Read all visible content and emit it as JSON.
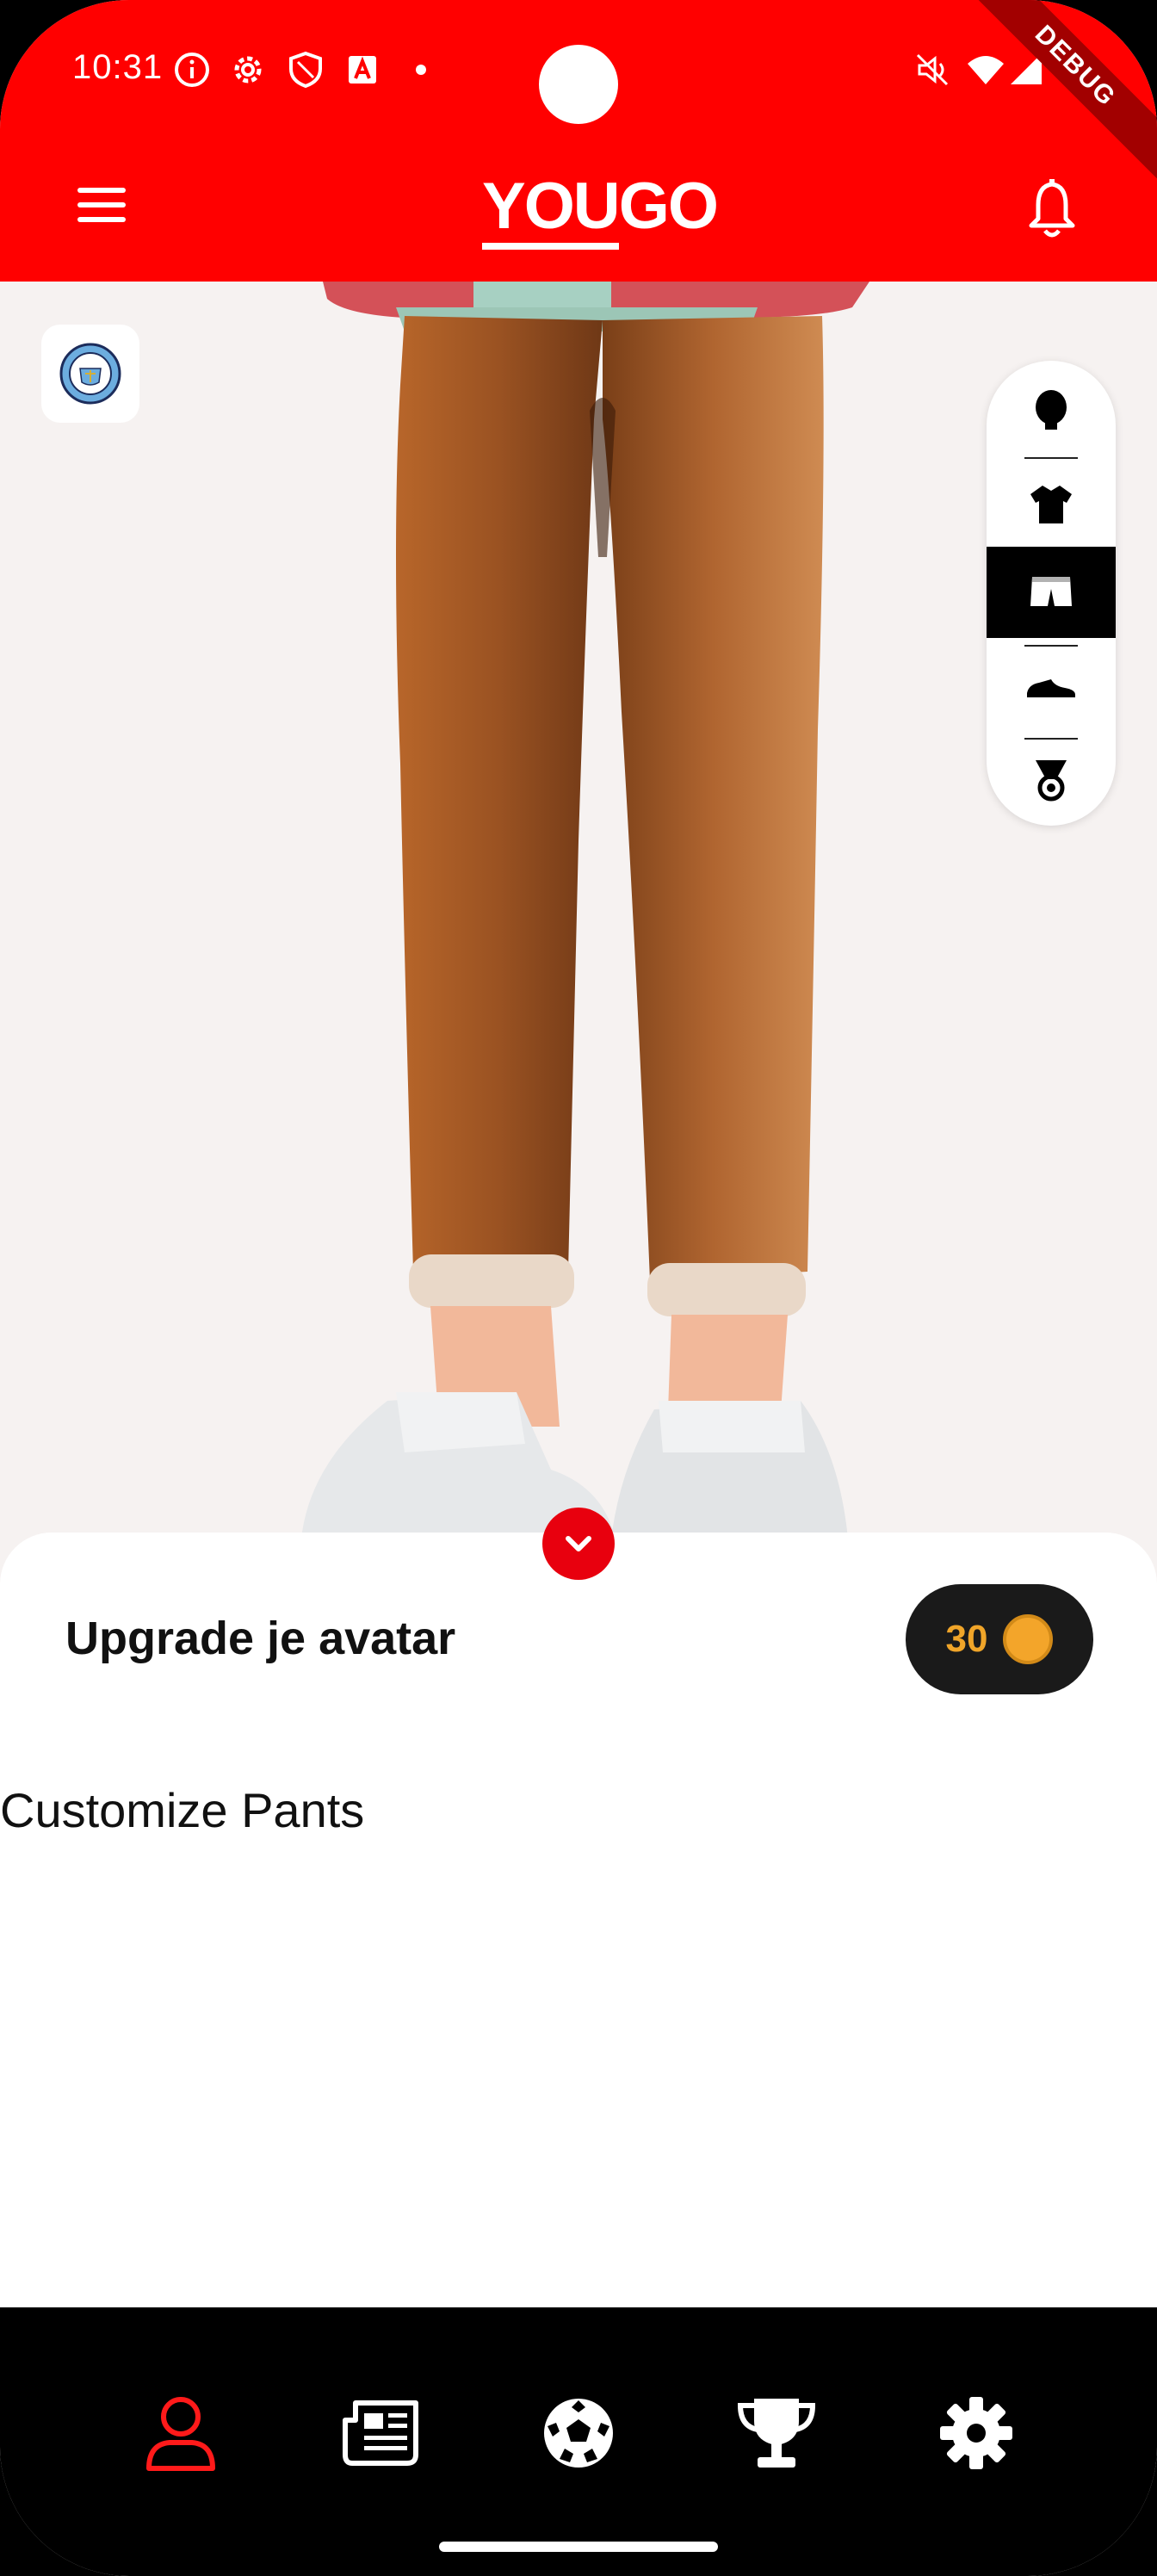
{
  "status_bar": {
    "time": "10:31",
    "left_icons": [
      "info-icon",
      "gear-icon",
      "shield-icon",
      "a-box-icon",
      "dot-icon"
    ],
    "right_icons": [
      "mute-icon",
      "wifi-icon",
      "signal-icon",
      "battery-icon"
    ],
    "debug_label": "DEBUG"
  },
  "app_bar": {
    "logo_part1": "YOU",
    "logo_part2": "GO",
    "background": "#ff0000"
  },
  "avatar": {
    "club_badge_icon": "manchester-city-badge-icon",
    "category_picker": [
      "head-icon",
      "shirt-icon",
      "pants-icon",
      "shoe-icon",
      "medal-icon"
    ],
    "active_category": "pants-icon"
  },
  "sheet": {
    "title": "Upgrade je avatar",
    "coin_balance": "30",
    "subtitle": "Customize Pants"
  },
  "bottom_nav": {
    "items": [
      "profile-icon",
      "news-icon",
      "football-icon",
      "trophy-icon",
      "settings-icon"
    ],
    "active": "profile-icon",
    "active_color": "#ff1a1a"
  }
}
